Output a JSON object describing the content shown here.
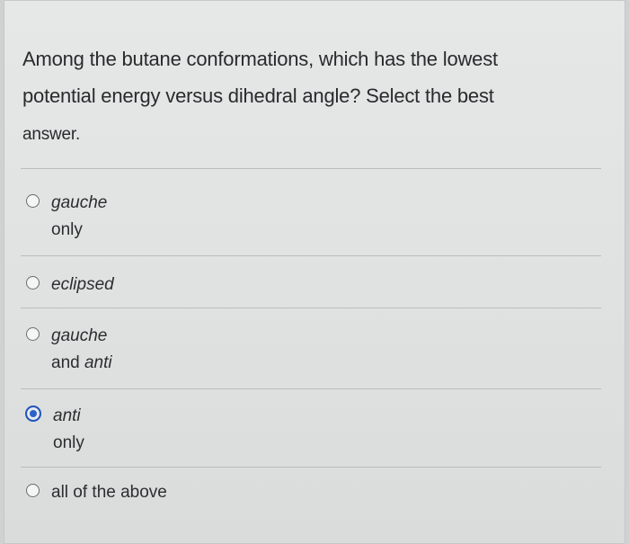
{
  "question": {
    "line1": "Among the butane conformations, which has the lowest",
    "line2": "potential energy versus dihedral angle? Select the best",
    "line3": "answer."
  },
  "options": [
    {
      "part1": "gauche",
      "part2": "only",
      "selected": false
    },
    {
      "part1": "eclipsed",
      "selected": false
    },
    {
      "part1": "gauche",
      "part2": "and",
      "part3": "anti",
      "selected": false
    },
    {
      "part1": "anti",
      "part2": "only",
      "selected": true
    },
    {
      "part1": "all of the above",
      "selected": false
    }
  ],
  "colors": {
    "selected_radio": "#2c63c9",
    "text": "#2d2d30"
  }
}
